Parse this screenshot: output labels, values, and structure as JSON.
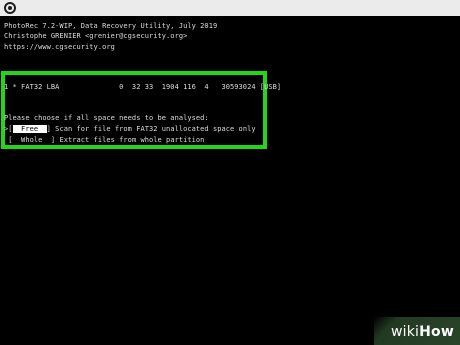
{
  "terminal": {
    "header_lines": [
      "PhotoRec 7.2-WIP, Data Recovery Utility, July 2019",
      "Christophe GRENIER <grenier@cgsecurity.org>",
      "https://www.cgsecurity.org"
    ],
    "partition_line": "1 * FAT32 LBA              0  32 33  1904 116  4   30593024 [USB]",
    "prompt": "Please choose if all space needs to be analysed:",
    "options": [
      {
        "prefix": ">[",
        "label": "  Free  ",
        "suffix": "] Scan for file from FAT32 unallocated space only",
        "selected": true
      },
      {
        "prefix": " [",
        "label": "  Whole  ",
        "suffix": "] Extract files from whole partition",
        "selected": false
      }
    ]
  },
  "highlight_color": "#22d61b",
  "watermark": {
    "part1": "wiki",
    "part2": "How"
  }
}
